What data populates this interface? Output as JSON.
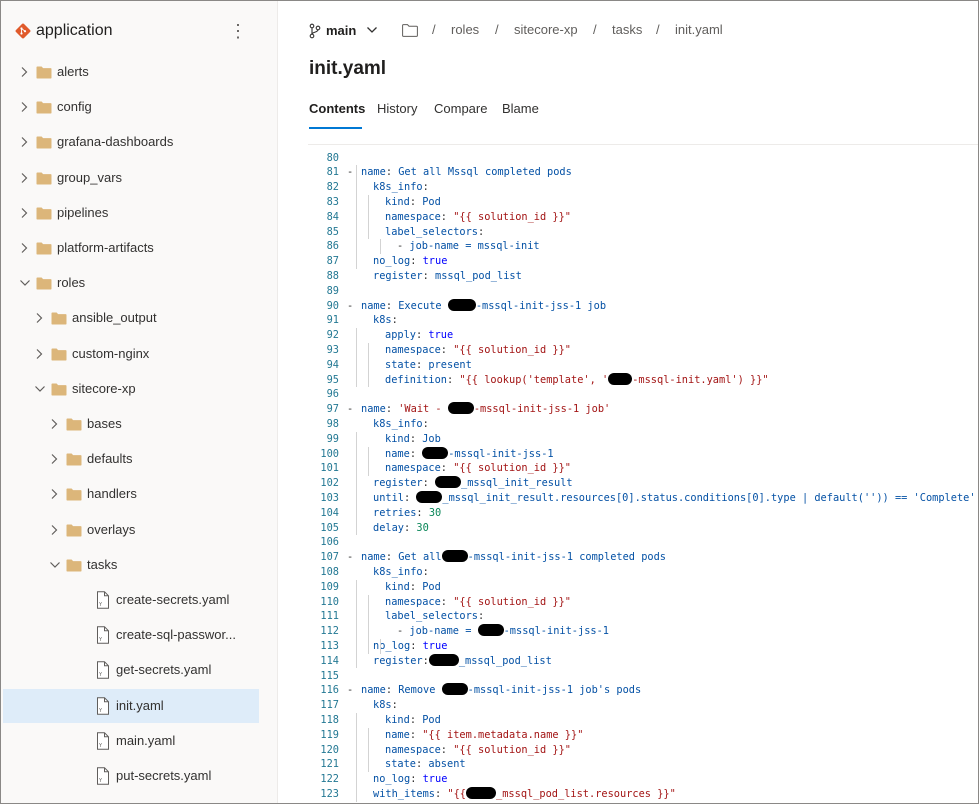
{
  "app": {
    "title": "application"
  },
  "tree": [
    {
      "label": "alerts",
      "type": "folder",
      "depth": 0,
      "expanded": false
    },
    {
      "label": "config",
      "type": "folder",
      "depth": 0,
      "expanded": false
    },
    {
      "label": "grafana-dashboards",
      "type": "folder",
      "depth": 0,
      "expanded": false
    },
    {
      "label": "group_vars",
      "type": "folder",
      "depth": 0,
      "expanded": false
    },
    {
      "label": "pipelines",
      "type": "folder",
      "depth": 0,
      "expanded": false
    },
    {
      "label": "platform-artifacts",
      "type": "folder",
      "depth": 0,
      "expanded": false
    },
    {
      "label": "roles",
      "type": "folder",
      "depth": 0,
      "expanded": true
    },
    {
      "label": "ansible_output",
      "type": "folder",
      "depth": 1,
      "expanded": false
    },
    {
      "label": "custom-nginx",
      "type": "folder",
      "depth": 1,
      "expanded": false
    },
    {
      "label": "sitecore-xp",
      "type": "folder",
      "depth": 1,
      "expanded": true
    },
    {
      "label": "bases",
      "type": "folder",
      "depth": 2,
      "expanded": false
    },
    {
      "label": "defaults",
      "type": "folder",
      "depth": 2,
      "expanded": false
    },
    {
      "label": "handlers",
      "type": "folder",
      "depth": 2,
      "expanded": false
    },
    {
      "label": "overlays",
      "type": "folder",
      "depth": 2,
      "expanded": false
    },
    {
      "label": "tasks",
      "type": "folder",
      "depth": 2,
      "expanded": true
    },
    {
      "label": "create-secrets.yaml",
      "type": "file",
      "depth": 3
    },
    {
      "label": "create-sql-passwor...",
      "type": "file",
      "depth": 3
    },
    {
      "label": "get-secrets.yaml",
      "type": "file",
      "depth": 3
    },
    {
      "label": "init.yaml",
      "type": "file",
      "depth": 3,
      "selected": true
    },
    {
      "label": "main.yaml",
      "type": "file",
      "depth": 3
    },
    {
      "label": "put-secrets.yaml",
      "type": "file",
      "depth": 3
    }
  ],
  "branch": {
    "name": "main"
  },
  "breadcrumb": [
    "roles",
    "sitecore-xp",
    "tasks",
    "init.yaml"
  ],
  "breadcrumb_separator": "/",
  "file": {
    "title": "init.yaml"
  },
  "tabs": [
    "Contents",
    "History",
    "Compare",
    "Blame"
  ],
  "code": [
    {
      "n": "80",
      "fold": "",
      "indent": 0,
      "segs": []
    },
    {
      "n": "81",
      "fold": "-",
      "indent": 0,
      "segs": [
        [
          "k",
          "name"
        ],
        [
          "p",
          ": "
        ],
        [
          "k",
          "Get all Mssql completed pods"
        ]
      ]
    },
    {
      "n": "82",
      "fold": "",
      "indent": 1,
      "segs": [
        [
          "k",
          "k8s_info"
        ],
        [
          "p",
          ":"
        ]
      ]
    },
    {
      "n": "83",
      "fold": "",
      "indent": 2,
      "segs": [
        [
          "k",
          "kind"
        ],
        [
          "p",
          ": "
        ],
        [
          "k",
          "Pod"
        ]
      ]
    },
    {
      "n": "84",
      "fold": "",
      "indent": 2,
      "segs": [
        [
          "k",
          "namespace"
        ],
        [
          "p",
          ": "
        ],
        [
          "s",
          "\"{{ solution_id }}\""
        ]
      ]
    },
    {
      "n": "85",
      "fold": "",
      "indent": 2,
      "segs": [
        [
          "k",
          "label_selectors"
        ],
        [
          "p",
          ":"
        ]
      ]
    },
    {
      "n": "86",
      "fold": "",
      "indent": 3,
      "segs": [
        [
          "p",
          "- "
        ],
        [
          "k",
          "job-name = mssql-init"
        ]
      ]
    },
    {
      "n": "87",
      "fold": "",
      "indent": 1,
      "segs": [
        [
          "k",
          "no_log"
        ],
        [
          "p",
          ": "
        ],
        [
          "b",
          "true"
        ]
      ]
    },
    {
      "n": "88",
      "fold": "",
      "indent": 1,
      "segs": [
        [
          "k",
          "register"
        ],
        [
          "p",
          ": "
        ],
        [
          "k",
          "mssql_pod_list"
        ]
      ]
    },
    {
      "n": "89",
      "fold": "",
      "indent": 0,
      "segs": []
    },
    {
      "n": "90",
      "fold": "-",
      "indent": 0,
      "segs": [
        [
          "k",
          "name"
        ],
        [
          "p",
          ": "
        ],
        [
          "k",
          "Execute "
        ],
        [
          "r",
          "28"
        ],
        [
          "k",
          "-mssql-init-jss-1 job"
        ]
      ]
    },
    {
      "n": "91",
      "fold": "",
      "indent": 1,
      "segs": [
        [
          "k",
          "k8s"
        ],
        [
          "p",
          ":"
        ]
      ]
    },
    {
      "n": "92",
      "fold": "",
      "indent": 2,
      "segs": [
        [
          "k",
          "apply"
        ],
        [
          "p",
          ": "
        ],
        [
          "b",
          "true"
        ]
      ]
    },
    {
      "n": "93",
      "fold": "",
      "indent": 2,
      "segs": [
        [
          "k",
          "namespace"
        ],
        [
          "p",
          ": "
        ],
        [
          "s",
          "\"{{ solution_id }}\""
        ]
      ]
    },
    {
      "n": "94",
      "fold": "",
      "indent": 2,
      "segs": [
        [
          "k",
          "state"
        ],
        [
          "p",
          ": "
        ],
        [
          "k",
          "present"
        ]
      ]
    },
    {
      "n": "95",
      "fold": "",
      "indent": 2,
      "segs": [
        [
          "k",
          "definition"
        ],
        [
          "p",
          ": "
        ],
        [
          "s",
          "\"{{ lookup('template', '"
        ],
        [
          "r",
          "24"
        ],
        [
          "s",
          "-mssql-init.yaml') }}\""
        ]
      ]
    },
    {
      "n": "96",
      "fold": "",
      "indent": 0,
      "segs": []
    },
    {
      "n": "97",
      "fold": "-",
      "indent": 0,
      "segs": [
        [
          "k",
          "name"
        ],
        [
          "p",
          ": "
        ],
        [
          "s",
          "'Wait - "
        ],
        [
          "r",
          "26"
        ],
        [
          "s",
          "-mssql-init-jss-1 job'"
        ]
      ]
    },
    {
      "n": "98",
      "fold": "",
      "indent": 1,
      "segs": [
        [
          "k",
          "k8s_info"
        ],
        [
          "p",
          ":"
        ]
      ]
    },
    {
      "n": "99",
      "fold": "",
      "indent": 2,
      "segs": [
        [
          "k",
          "kind"
        ],
        [
          "p",
          ": "
        ],
        [
          "k",
          "Job"
        ]
      ]
    },
    {
      "n": "100",
      "fold": "",
      "indent": 2,
      "segs": [
        [
          "k",
          "name"
        ],
        [
          "p",
          ": "
        ],
        [
          "r",
          "26"
        ],
        [
          "k",
          "-mssql-init-jss-1"
        ]
      ]
    },
    {
      "n": "101",
      "fold": "",
      "indent": 2,
      "segs": [
        [
          "k",
          "namespace"
        ],
        [
          "p",
          ": "
        ],
        [
          "s",
          "\"{{ solution_id }}\""
        ]
      ]
    },
    {
      "n": "102",
      "fold": "",
      "indent": 1,
      "segs": [
        [
          "k",
          "register"
        ],
        [
          "p",
          ": "
        ],
        [
          "r",
          "26"
        ],
        [
          "k",
          "_mssql_init_result"
        ]
      ]
    },
    {
      "n": "103",
      "fold": "",
      "indent": 1,
      "segs": [
        [
          "k",
          "until"
        ],
        [
          "p",
          ": "
        ],
        [
          "r",
          "26"
        ],
        [
          "k",
          "_mssql_init_result.resources[0].status.conditions[0].type | default('')) == 'Complete'"
        ]
      ]
    },
    {
      "n": "104",
      "fold": "",
      "indent": 1,
      "segs": [
        [
          "k",
          "retries"
        ],
        [
          "p",
          ": "
        ],
        [
          "n",
          "30"
        ]
      ]
    },
    {
      "n": "105",
      "fold": "",
      "indent": 1,
      "segs": [
        [
          "k",
          "delay"
        ],
        [
          "p",
          ": "
        ],
        [
          "n",
          "30"
        ]
      ]
    },
    {
      "n": "106",
      "fold": "",
      "indent": 0,
      "segs": []
    },
    {
      "n": "107",
      "fold": "-",
      "indent": 0,
      "segs": [
        [
          "k",
          "name"
        ],
        [
          "p",
          ": "
        ],
        [
          "k",
          "Get all"
        ],
        [
          "r",
          "26"
        ],
        [
          "k",
          "-mssql-init-jss-1 completed pods"
        ]
      ]
    },
    {
      "n": "108",
      "fold": "",
      "indent": 1,
      "segs": [
        [
          "k",
          "k8s_info"
        ],
        [
          "p",
          ":"
        ]
      ]
    },
    {
      "n": "109",
      "fold": "",
      "indent": 2,
      "segs": [
        [
          "k",
          "kind"
        ],
        [
          "p",
          ": "
        ],
        [
          "k",
          "Pod"
        ]
      ]
    },
    {
      "n": "110",
      "fold": "",
      "indent": 2,
      "segs": [
        [
          "k",
          "namespace"
        ],
        [
          "p",
          ": "
        ],
        [
          "s",
          "\"{{ solution_id }}\""
        ]
      ]
    },
    {
      "n": "111",
      "fold": "",
      "indent": 2,
      "segs": [
        [
          "k",
          "label_selectors"
        ],
        [
          "p",
          ":"
        ]
      ]
    },
    {
      "n": "112",
      "fold": "",
      "indent": 3,
      "segs": [
        [
          "p",
          "- "
        ],
        [
          "k",
          "job-name = "
        ],
        [
          "r",
          "26"
        ],
        [
          "k",
          "-mssql-init-jss-1"
        ]
      ]
    },
    {
      "n": "113",
      "fold": "",
      "indent": 1,
      "segs": [
        [
          "k",
          "no_log"
        ],
        [
          "p",
          ": "
        ],
        [
          "b",
          "true"
        ]
      ]
    },
    {
      "n": "114",
      "fold": "",
      "indent": 1,
      "segs": [
        [
          "k",
          "register"
        ],
        [
          "p",
          ":"
        ],
        [
          "r",
          "30"
        ],
        [
          "k",
          "_mssql_pod_list"
        ]
      ]
    },
    {
      "n": "115",
      "fold": "",
      "indent": 0,
      "segs": []
    },
    {
      "n": "116",
      "fold": "-",
      "indent": 0,
      "segs": [
        [
          "k",
          "name"
        ],
        [
          "p",
          ": "
        ],
        [
          "k",
          "Remove "
        ],
        [
          "r",
          "26"
        ],
        [
          "k",
          "-mssql-init-jss-1 job's pods"
        ]
      ]
    },
    {
      "n": "117",
      "fold": "",
      "indent": 1,
      "segs": [
        [
          "k",
          "k8s"
        ],
        [
          "p",
          ":"
        ]
      ]
    },
    {
      "n": "118",
      "fold": "",
      "indent": 2,
      "segs": [
        [
          "k",
          "kind"
        ],
        [
          "p",
          ": "
        ],
        [
          "k",
          "Pod"
        ]
      ]
    },
    {
      "n": "119",
      "fold": "",
      "indent": 2,
      "segs": [
        [
          "k",
          "name"
        ],
        [
          "p",
          ": "
        ],
        [
          "s",
          "\"{{ item.metadata.name }}\""
        ]
      ]
    },
    {
      "n": "120",
      "fold": "",
      "indent": 2,
      "segs": [
        [
          "k",
          "namespace"
        ],
        [
          "p",
          ": "
        ],
        [
          "s",
          "\"{{ solution_id }}\""
        ]
      ]
    },
    {
      "n": "121",
      "fold": "",
      "indent": 2,
      "segs": [
        [
          "k",
          "state"
        ],
        [
          "p",
          ": "
        ],
        [
          "k",
          "absent"
        ]
      ]
    },
    {
      "n": "122",
      "fold": "",
      "indent": 1,
      "segs": [
        [
          "k",
          "no_log"
        ],
        [
          "p",
          ": "
        ],
        [
          "b",
          "true"
        ]
      ]
    },
    {
      "n": "123",
      "fold": "",
      "indent": 1,
      "segs": [
        [
          "k",
          "with_items"
        ],
        [
          "p",
          ": "
        ],
        [
          "s",
          "\"{{"
        ],
        [
          "r",
          "30"
        ],
        [
          "s",
          "_mssql_pod_list.resources }}\""
        ]
      ]
    }
  ],
  "colors": {
    "accent": "#0078d4",
    "selected_bg": "#deecf9",
    "folder": "#dcb67a",
    "logo": "#e05a2b"
  },
  "icons": {
    "logo": "git-logo-icon",
    "more": "more-vertical-icon",
    "branch": "branch-icon",
    "folder": "folder-icon",
    "file": "file-icon",
    "chevron_right": "chevron-right-icon",
    "chevron_down": "chevron-down-icon"
  }
}
